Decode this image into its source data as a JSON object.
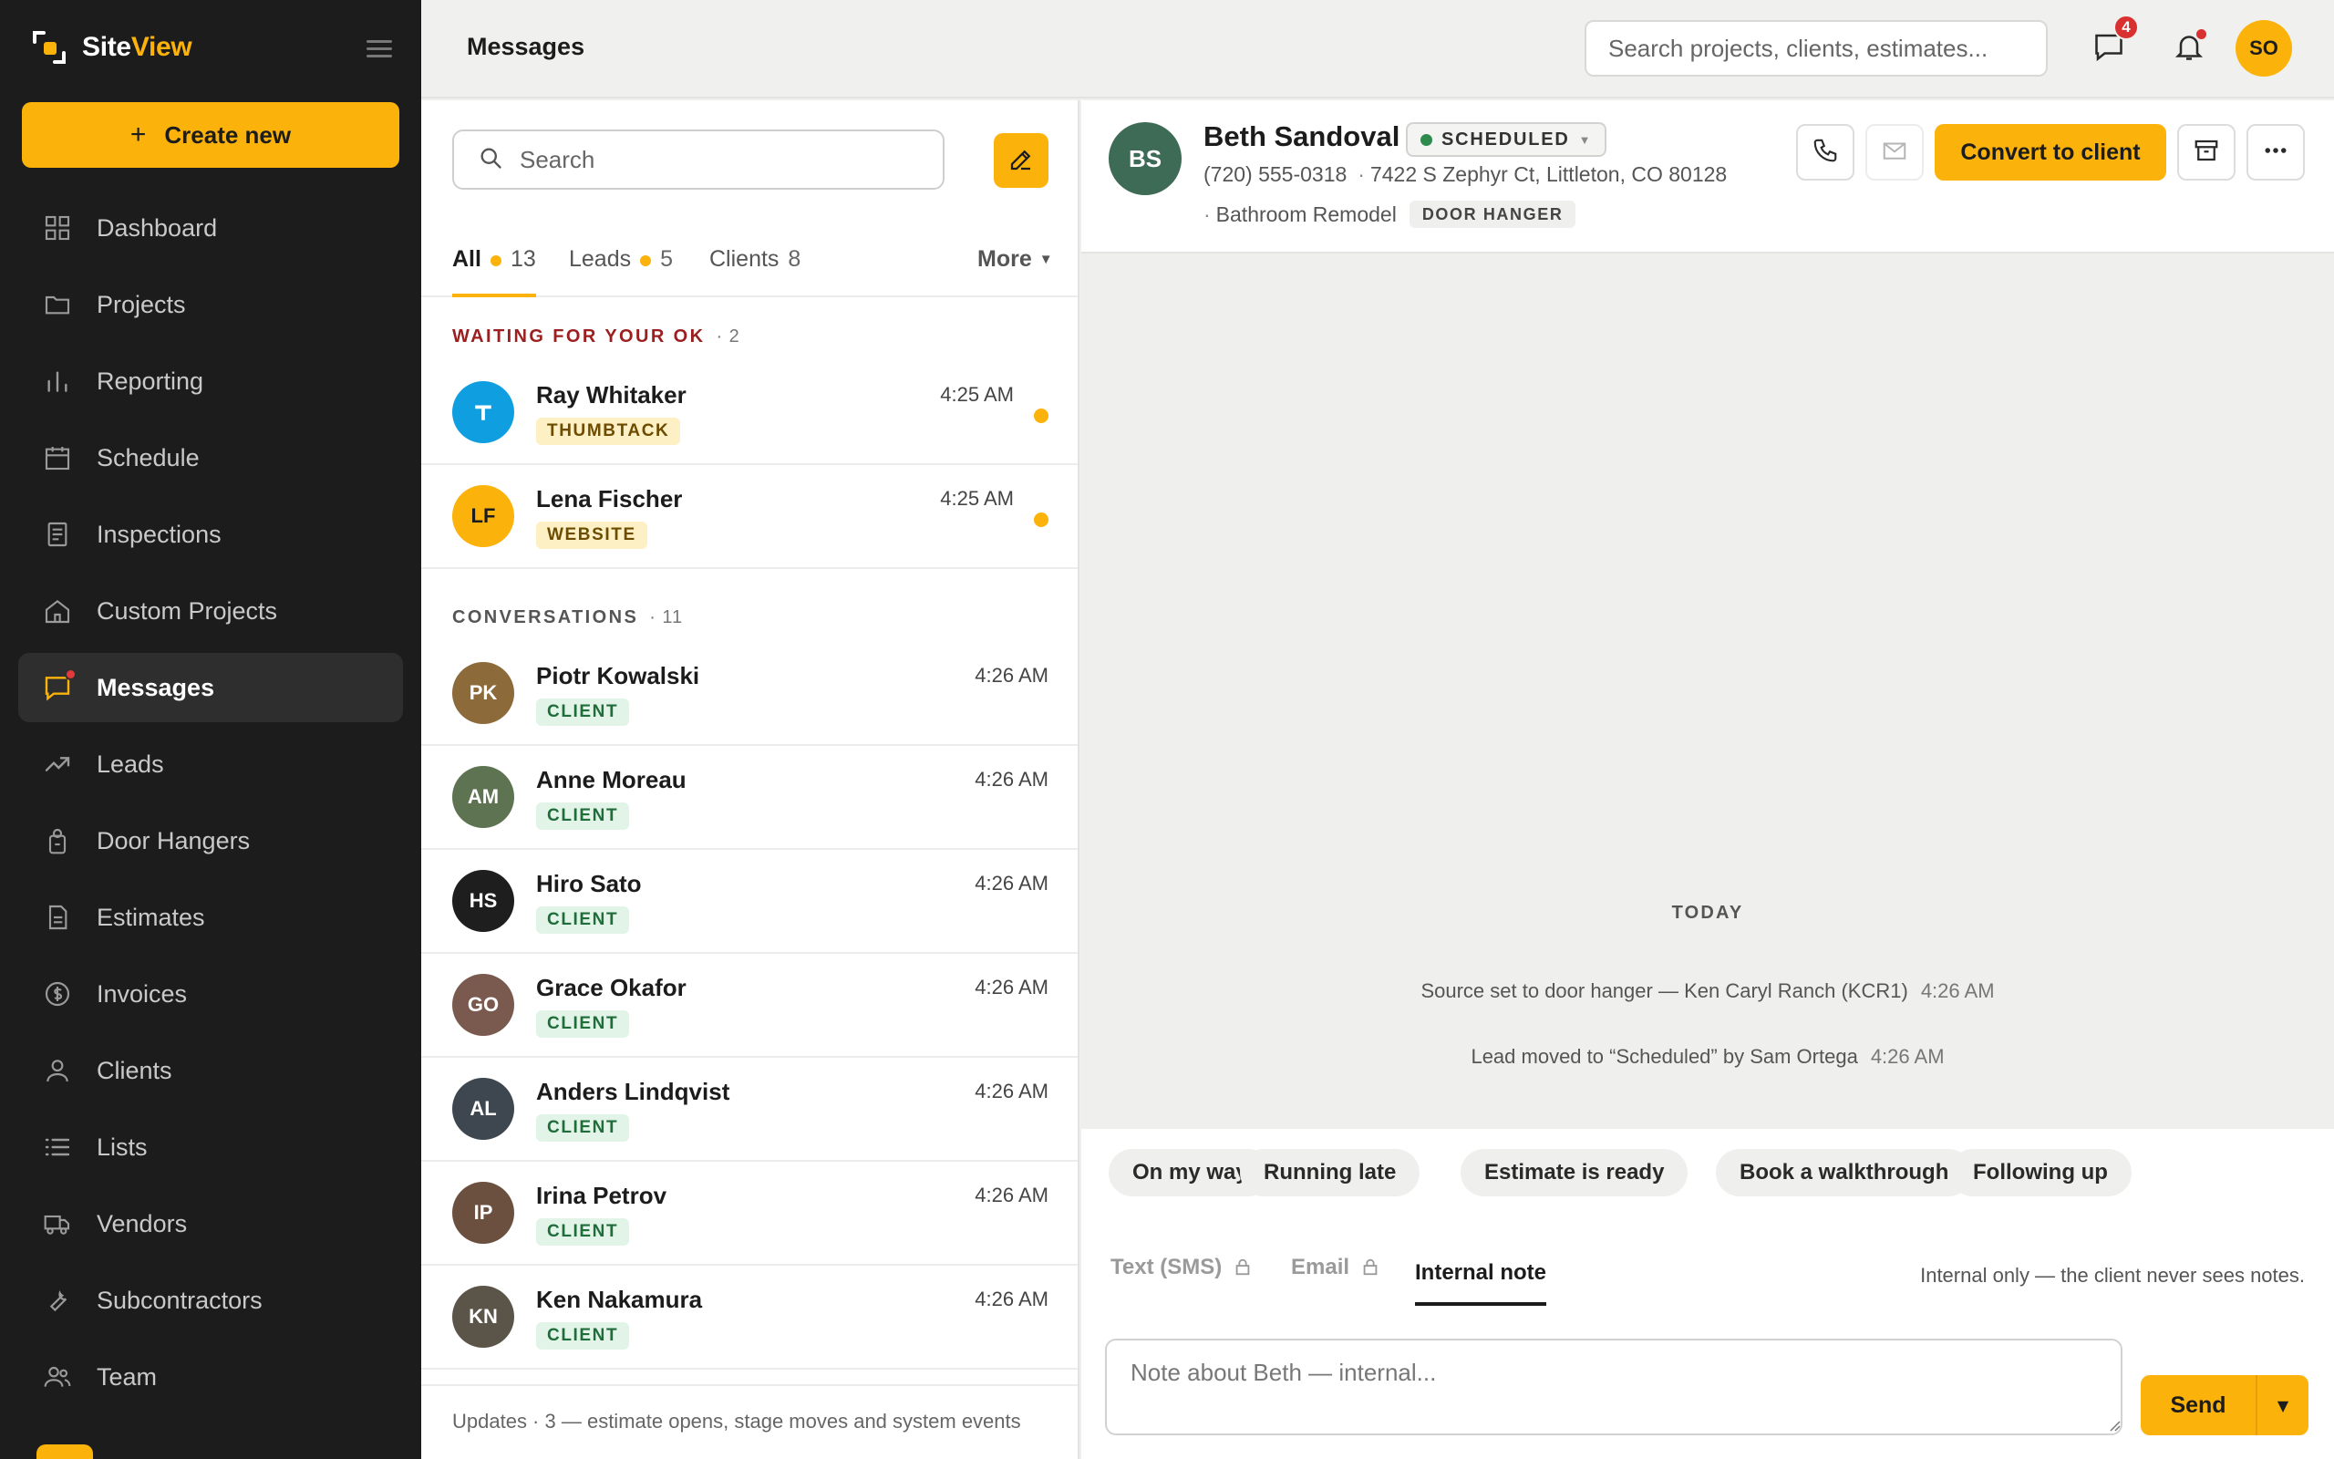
{
  "brand": {
    "name_prefix": "Site",
    "name_suffix": "View"
  },
  "sidebar": {
    "create_label": "Create new",
    "items": [
      {
        "label": "Dashboard",
        "icon": "grid-icon"
      },
      {
        "label": "Projects",
        "icon": "folder-icon"
      },
      {
        "label": "Reporting",
        "icon": "bar-chart-icon"
      },
      {
        "label": "Schedule",
        "icon": "calendar-icon"
      },
      {
        "label": "Inspections",
        "icon": "clipboard-icon"
      },
      {
        "label": "Custom Projects",
        "icon": "house-icon"
      },
      {
        "label": "Messages",
        "icon": "chat-icon"
      },
      {
        "label": "Leads",
        "icon": "trend-up-icon"
      },
      {
        "label": "Door Hangers",
        "icon": "door-hanger-icon"
      },
      {
        "label": "Estimates",
        "icon": "document-icon"
      },
      {
        "label": "Invoices",
        "icon": "dollar-icon"
      },
      {
        "label": "Clients",
        "icon": "person-icon"
      },
      {
        "label": "Lists",
        "icon": "list-icon"
      },
      {
        "label": "Vendors",
        "icon": "truck-icon"
      },
      {
        "label": "Subcontractors",
        "icon": "wrench-icon"
      },
      {
        "label": "Team",
        "icon": "team-icon"
      }
    ],
    "active": "Messages"
  },
  "topbar": {
    "title": "Messages",
    "search_placeholder": "Search projects, clients, estimates...",
    "messages_badge": "4",
    "user_initials": "SO"
  },
  "list": {
    "search_placeholder": "Search",
    "tabs": {
      "all_label": "All",
      "all_count": "13",
      "leads_label": "Leads",
      "leads_count": "5",
      "clients_label": "Clients",
      "clients_count": "8",
      "more_label": "More"
    },
    "waiting_title": "WAITING FOR YOUR OK",
    "waiting_count": "· 2",
    "waiting": [
      {
        "initials": "T",
        "name": "Ray Whitaker",
        "time": "4:25 AM",
        "tag": "THUMBTACK",
        "avatar_color": "#0f9ee0"
      },
      {
        "initials": "LF",
        "name": "Lena Fischer",
        "time": "4:25 AM",
        "tag": "WEBSITE",
        "avatar_color": "#fbb20a"
      }
    ],
    "conversations_title": "CONVERSATIONS",
    "conversations_count": "· 11",
    "conversations": [
      {
        "initials": "PK",
        "name": "Piotr Kowalski",
        "time": "4:26 AM",
        "tag": "CLIENT",
        "avatar_color": "#8c6a3a"
      },
      {
        "initials": "AM",
        "name": "Anne Moreau",
        "time": "4:26 AM",
        "tag": "CLIENT",
        "avatar_color": "#5d7352"
      },
      {
        "initials": "HS",
        "name": "Hiro Sato",
        "time": "4:26 AM",
        "tag": "CLIENT",
        "avatar_color": "#1e1e1e"
      },
      {
        "initials": "GO",
        "name": "Grace Okafor",
        "time": "4:26 AM",
        "tag": "CLIENT",
        "avatar_color": "#7a5a4e"
      },
      {
        "initials": "AL",
        "name": "Anders Lindqvist",
        "time": "4:26 AM",
        "tag": "CLIENT",
        "avatar_color": "#3e4750"
      },
      {
        "initials": "IP",
        "name": "Irina Petrov",
        "time": "4:26 AM",
        "tag": "CLIENT",
        "avatar_color": "#6b5040"
      },
      {
        "initials": "KN",
        "name": "Ken Nakamura",
        "time": "4:26 AM",
        "tag": "CLIENT",
        "avatar_color": "#5b5448"
      }
    ],
    "footer": "Updates · 3 — estimate opens, stage moves and system events"
  },
  "thread": {
    "initials": "BS",
    "name": "Beth Sandoval",
    "status": "SCHEDULED",
    "phone": "(720) 555-0318",
    "address": "7422 S Zephyr Ct, Littleton, CO 80128",
    "project": "Bathroom Remodel",
    "source_tag": "DOOR HANGER",
    "convert_label": "Convert to client",
    "day_label": "TODAY",
    "events": [
      {
        "text": "Source set to door hanger — Ken Caryl Ranch (KCR1)",
        "time": "4:26 AM"
      },
      {
        "text": "Lead moved to “Scheduled” by Sam Ortega",
        "time": "4:26 AM"
      }
    ]
  },
  "composer": {
    "quick_replies": [
      "On my way",
      "Running late",
      "Estimate is ready",
      "Book a walkthrough",
      "Following up"
    ],
    "modes": {
      "sms": "Text (SMS)",
      "email": "Email",
      "note": "Internal note"
    },
    "hint": "Internal only — the client never sees notes.",
    "placeholder": "Note about Beth — internal...",
    "send_label": "Send"
  },
  "colors": {
    "accent": "#fbb20a",
    "sidebar_bg": "#1c1c1c",
    "alert": "#d93030",
    "status_green": "#2f8a4d"
  }
}
